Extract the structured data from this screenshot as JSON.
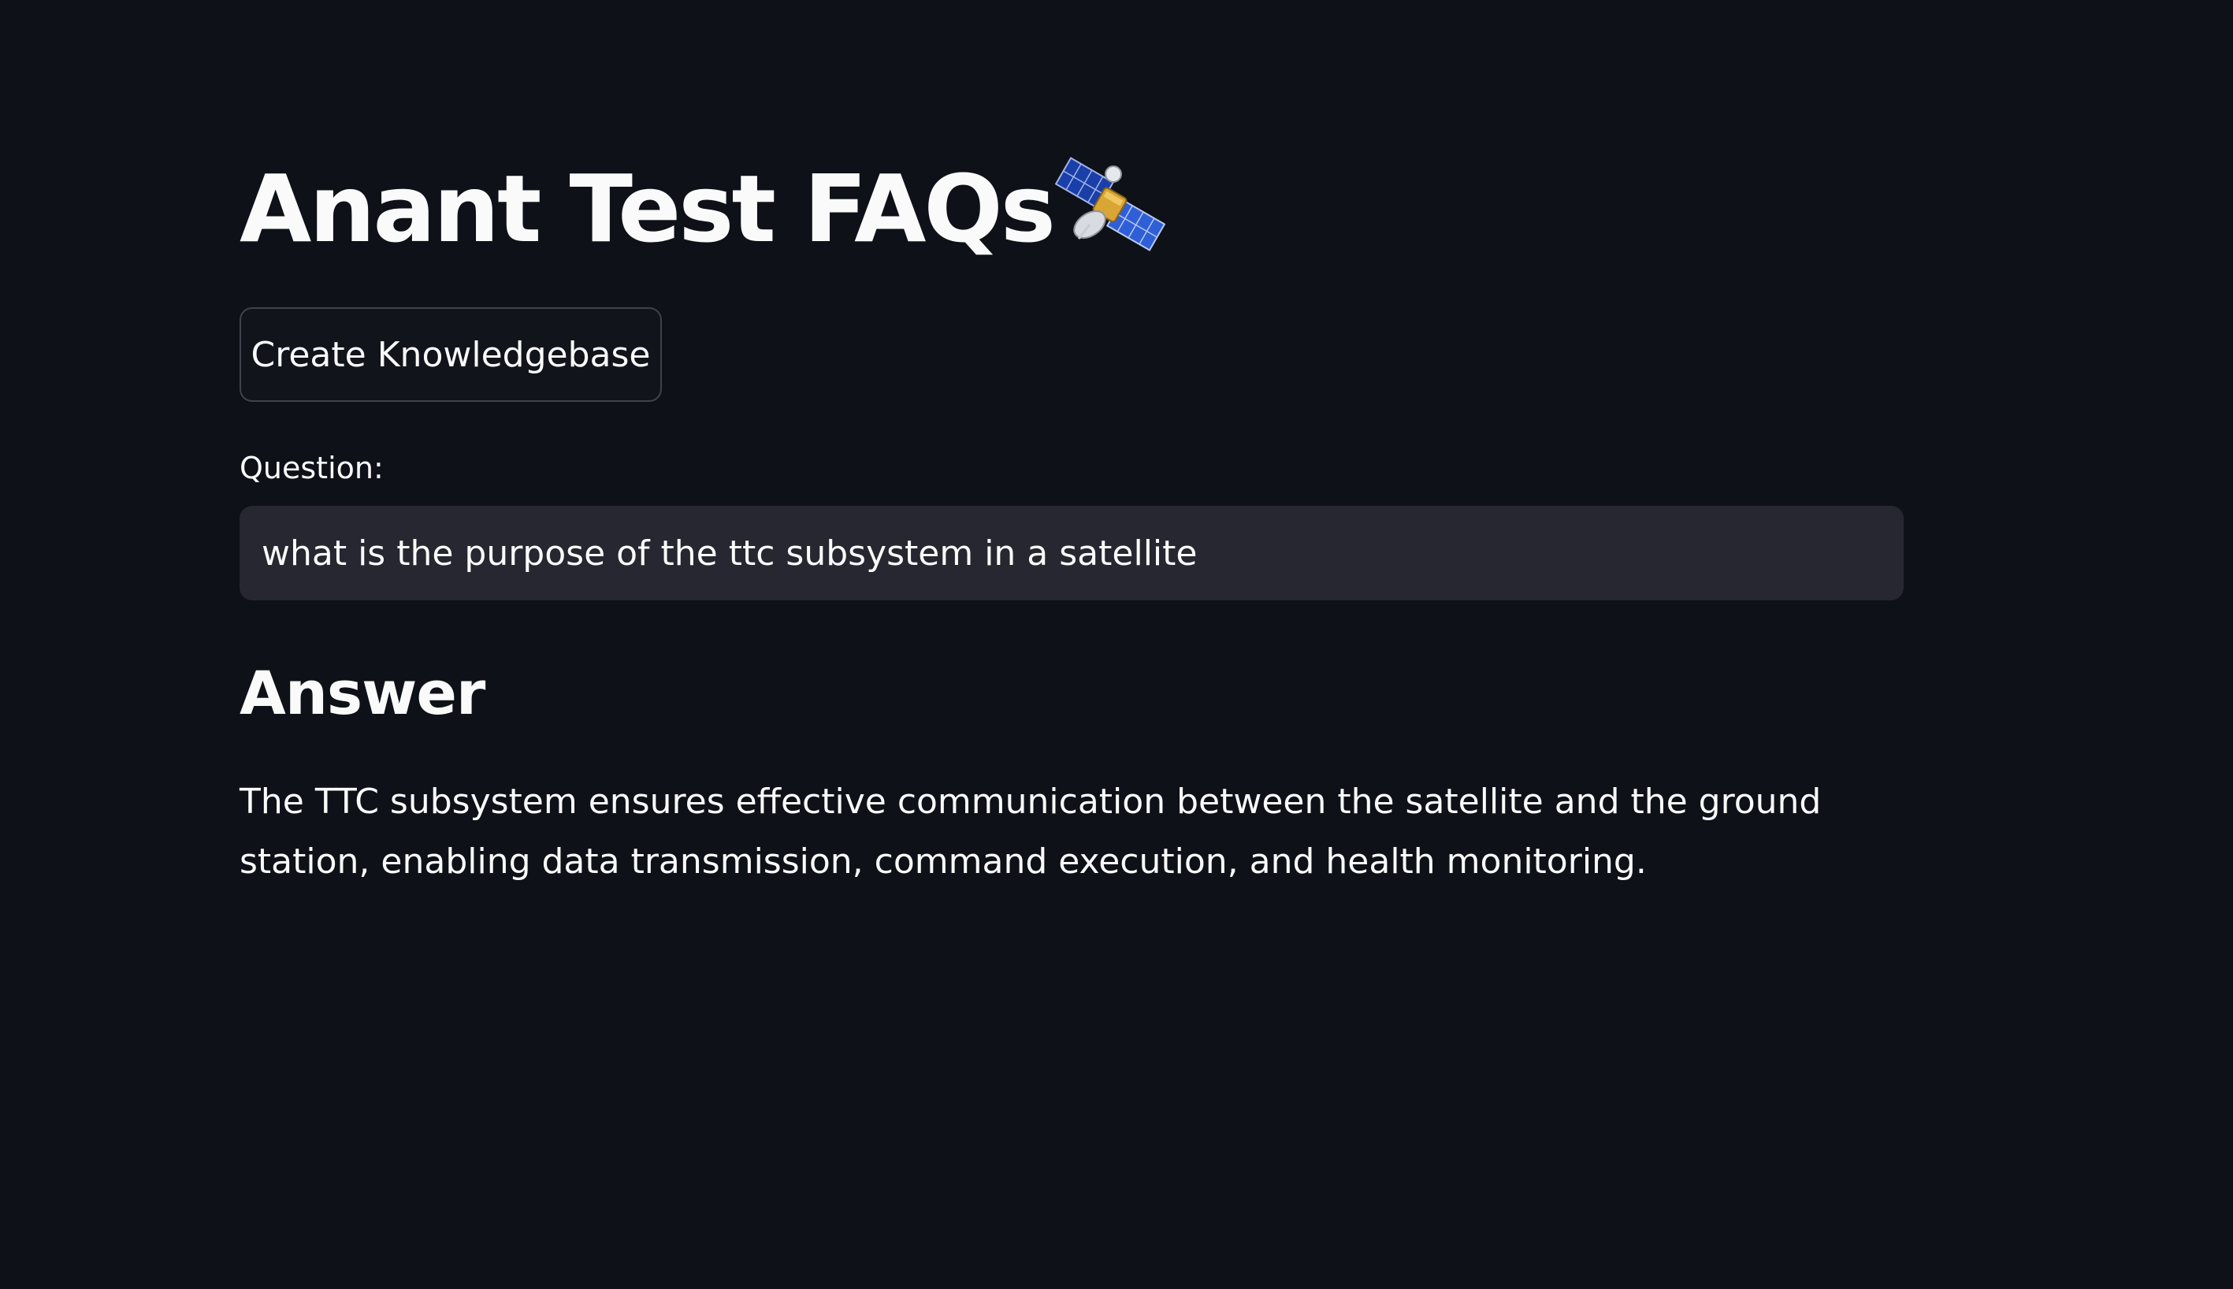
{
  "page": {
    "title": "Anant Test FAQs",
    "title_icon": "satellite-icon"
  },
  "actions": {
    "create_kb_label": "Create Knowledgebase"
  },
  "question": {
    "label": "Question:",
    "value": "what is the purpose of the ttc subsystem in a satellite"
  },
  "answer": {
    "heading": "Answer",
    "text": "The TTC subsystem ensures effective communication between the satellite and the ground station, enabling data transmission, command execution, and health monitoring."
  },
  "colors": {
    "background": "#0e1117",
    "text": "#fafafa",
    "input_background": "#262730",
    "button_border": "#3f424c"
  }
}
